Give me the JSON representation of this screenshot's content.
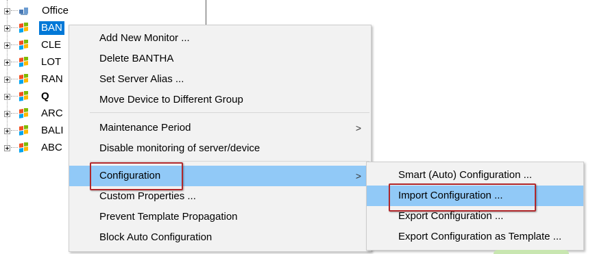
{
  "tree": {
    "items": [
      {
        "label": "Office",
        "icon": "group-icon",
        "bold": false,
        "selected": false
      },
      {
        "label": "BAN",
        "icon": "windows-server-icon",
        "bold": false,
        "selected": true
      },
      {
        "label": "CLE",
        "icon": "windows-server-icon",
        "bold": false,
        "selected": false
      },
      {
        "label": "LOT",
        "icon": "windows-server-icon",
        "bold": false,
        "selected": false
      },
      {
        "label": "RAN",
        "icon": "windows-server-icon",
        "bold": false,
        "selected": false
      },
      {
        "label": "Q",
        "icon": "windows-server-icon",
        "bold": true,
        "selected": false
      },
      {
        "label": "ARC",
        "icon": "windows-server-icon",
        "bold": false,
        "selected": false
      },
      {
        "label": "BALI",
        "icon": "windows-server-icon",
        "bold": false,
        "selected": false
      },
      {
        "label": "ABC",
        "icon": "windows-server-icon",
        "bold": false,
        "selected": false
      }
    ]
  },
  "context_menu": {
    "items": [
      {
        "label": "Add New Monitor ..."
      },
      {
        "label": "Delete BANTHA"
      },
      {
        "label": "Set Server Alias ..."
      },
      {
        "label": "Move Device to Different Group"
      },
      {
        "label": "Maintenance Period",
        "submenu_arrow": ">"
      },
      {
        "label": "Disable monitoring of server/device"
      },
      {
        "label": "Configuration",
        "submenu_arrow": ">",
        "highlighted": true
      },
      {
        "label": "Custom Properties ..."
      },
      {
        "label": "Prevent Template Propagation"
      },
      {
        "label": "Block Auto Configuration"
      }
    ]
  },
  "submenu": {
    "items": [
      {
        "label": "Smart (Auto) Configuration ..."
      },
      {
        "label": "Import Configuration ...",
        "highlighted": true
      },
      {
        "label": "Export Configuration ..."
      },
      {
        "label": "Export Configuration as Template ..."
      }
    ]
  },
  "colors": {
    "selection_blue": "#0078d7",
    "menu_highlight": "#91c9f7",
    "callout_red": "#b0272b",
    "menu_background": "#f2f2f2"
  }
}
